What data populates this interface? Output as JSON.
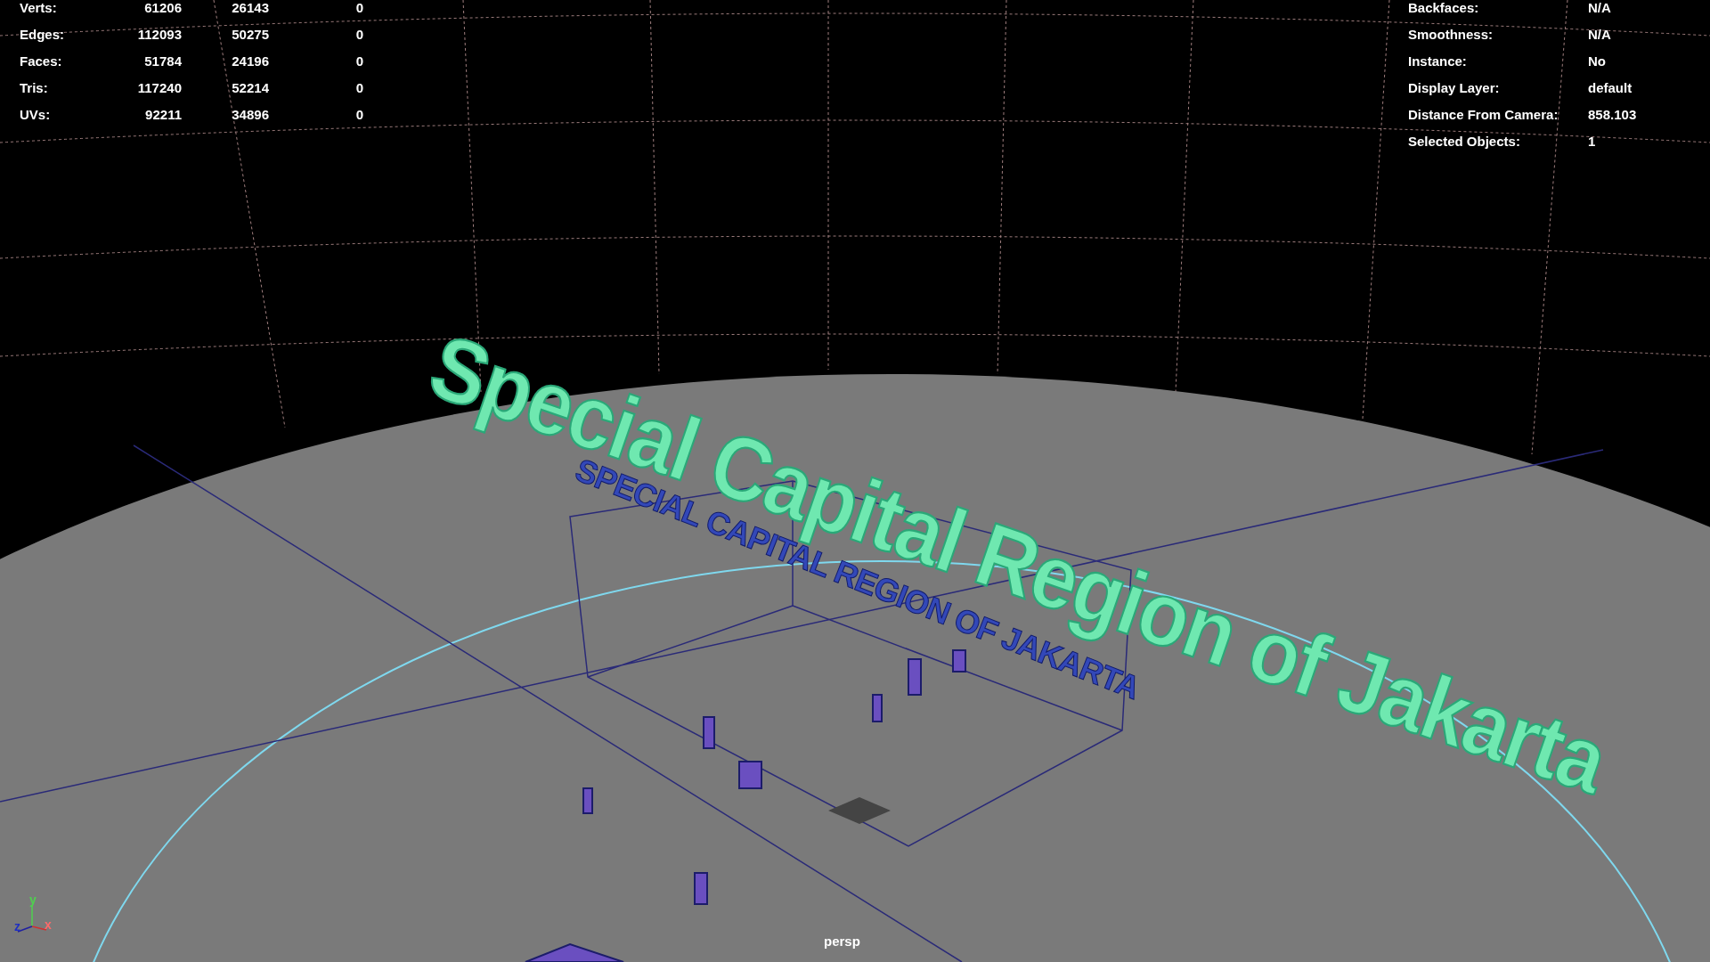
{
  "hud_left": {
    "rows": [
      {
        "label": "Verts:",
        "values": [
          "61206",
          "26143",
          "0"
        ]
      },
      {
        "label": "Edges:",
        "values": [
          "112093",
          "50275",
          "0"
        ]
      },
      {
        "label": "Faces:",
        "values": [
          "51784",
          "24196",
          "0"
        ]
      },
      {
        "label": "Tris:",
        "values": [
          "117240",
          "52214",
          "0"
        ]
      },
      {
        "label": "UVs:",
        "values": [
          "92211",
          "34896",
          "0"
        ]
      }
    ]
  },
  "hud_right": {
    "rows": [
      {
        "label": "Backfaces:",
        "value": "N/A"
      },
      {
        "label": "Smoothness:",
        "value": "N/A"
      },
      {
        "label": "Instance:",
        "value": "No"
      },
      {
        "label": "Display Layer:",
        "value": "default"
      },
      {
        "label": "Distance From Camera:",
        "value": "858.103"
      },
      {
        "label": "Selected Objects:",
        "value": "1"
      }
    ]
  },
  "scene_texts": [
    {
      "kind": "title",
      "text": "Special Capital Region of Jakarta"
    },
    {
      "kind": "caps",
      "text": "SPECIAL CAPITAL REGION OF JAKARTA"
    }
  ],
  "axis_labels": {
    "x": "x",
    "y": "y",
    "z": "z"
  },
  "camera": "persp"
}
